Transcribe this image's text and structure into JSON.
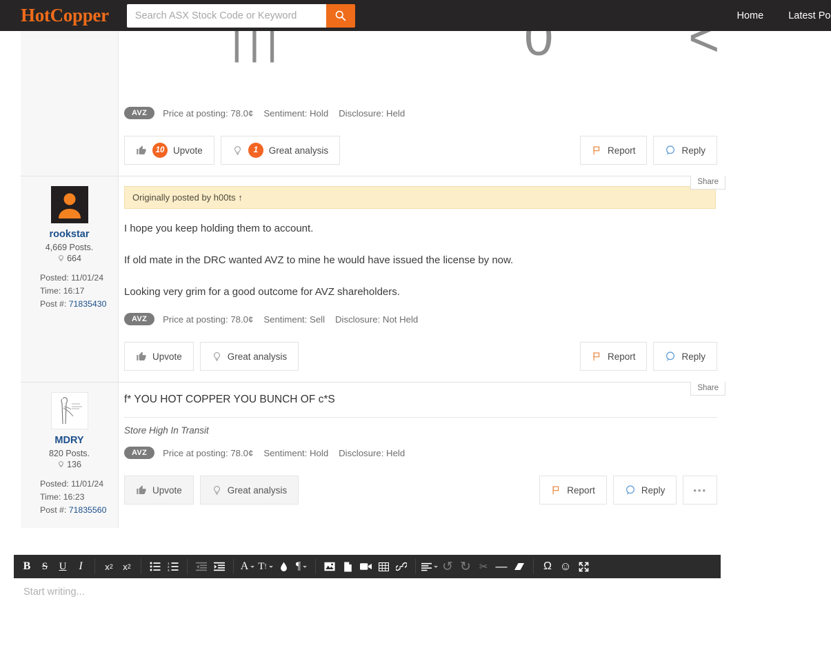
{
  "header": {
    "logo": "HotCopper",
    "search_placeholder": "Search ASX Stock Code or Keyword",
    "search_value": "",
    "search_icon": "search-icon",
    "nav": [
      {
        "label": "Home"
      },
      {
        "label": "Latest Posts"
      }
    ]
  },
  "truncated_post": {
    "glyphs": [
      "|||",
      "0",
      "<"
    ],
    "stock": {
      "ticker": "AVZ",
      "price": "Price at posting: 78.0¢",
      "sentiment": "Sentiment: Hold",
      "disclosure": "Disclosure: Held"
    },
    "actions": {
      "upvote": "Upvote",
      "upvote_count": "10",
      "great": "Great analysis",
      "great_count": "1",
      "report": "Report",
      "reply": "Reply"
    }
  },
  "posts": [
    {
      "share": "Share",
      "user": {
        "name": "rookstar",
        "posts": "4,669 Posts.",
        "bulb": "664",
        "posted": "Posted: 11/01/24",
        "time": "Time: 16:17",
        "postnum_label": "Post #:",
        "postnum": "71835430",
        "avatar_type": "orange-person"
      },
      "quote": "Originally posted by h00ts ↑",
      "paragraphs": [
        "I hope you keep holding them to account.",
        "If old mate in the DRC wanted AVZ to mine he would have issued the license by now.",
        "Looking very grim for a good outcome for AVZ shareholders."
      ],
      "stock": {
        "ticker": "AVZ",
        "price": "Price at posting: 78.0¢",
        "sentiment": "Sentiment: Sell",
        "disclosure": "Disclosure: Not Held"
      },
      "actions": {
        "upvote": "Upvote",
        "great": "Great analysis",
        "report": "Report",
        "reply": "Reply"
      }
    },
    {
      "share": "Share",
      "user": {
        "name": "MDRY",
        "posts": "820 Posts.",
        "bulb": "136",
        "posted": "Posted: 11/01/24",
        "time": "Time: 16:23",
        "postnum_label": "Post #:",
        "postnum": "71835560",
        "avatar_type": "sketch"
      },
      "title": "f* YOU HOT COPPER YOU BUNCH OF c*S",
      "signature": "Store High In Transit",
      "stock": {
        "ticker": "AVZ",
        "price": "Price at posting: 78.0¢",
        "sentiment": "Sentiment: Hold",
        "disclosure": "Disclosure: Held"
      },
      "actions": {
        "upvote": "Upvote",
        "great": "Great analysis",
        "report": "Report",
        "reply": "Reply",
        "more": "•••"
      }
    }
  ],
  "editor": {
    "placeholder": "Start writing...",
    "toolbar": [
      {
        "name": "bold-icon",
        "glyph": "B"
      },
      {
        "name": "strikethrough-icon",
        "glyph": "S"
      },
      {
        "name": "underline-icon",
        "glyph": "U"
      },
      {
        "name": "italic-icon",
        "glyph": "I"
      },
      {
        "name": "superscript-icon",
        "glyph": "x²"
      },
      {
        "name": "subscript-icon",
        "glyph": "x₂"
      },
      {
        "name": "bullet-list-icon",
        "glyph": "☰"
      },
      {
        "name": "numbered-list-icon",
        "glyph": "☰"
      },
      {
        "name": "outdent-icon",
        "glyph": "≡"
      },
      {
        "name": "indent-icon",
        "glyph": "≡"
      },
      {
        "name": "font-color-icon",
        "glyph": "A"
      },
      {
        "name": "font-size-icon",
        "glyph": "T!"
      },
      {
        "name": "highlight-color-icon",
        "glyph": "◆"
      },
      {
        "name": "paragraph-format-icon",
        "glyph": "¶"
      },
      {
        "name": "insert-image-icon",
        "glyph": "▣"
      },
      {
        "name": "insert-file-icon",
        "glyph": "□"
      },
      {
        "name": "insert-video-icon",
        "glyph": "▶"
      },
      {
        "name": "insert-table-icon",
        "glyph": "⊞"
      },
      {
        "name": "insert-link-icon",
        "glyph": "⚭"
      },
      {
        "name": "align-icon",
        "glyph": "≡"
      },
      {
        "name": "undo-icon",
        "glyph": "↺"
      },
      {
        "name": "redo-icon",
        "glyph": "↻"
      },
      {
        "name": "cut-icon",
        "glyph": "✂"
      },
      {
        "name": "horizontal-rule-icon",
        "glyph": "—"
      },
      {
        "name": "clear-formatting-icon",
        "glyph": "▱"
      },
      {
        "name": "special-character-icon",
        "glyph": "Ω"
      },
      {
        "name": "emoticon-icon",
        "glyph": "☺"
      },
      {
        "name": "fullscreen-icon",
        "glyph": "⤡"
      }
    ]
  },
  "colors": {
    "brand_orange": "#ef6c1a",
    "badge_orange": "#f26522",
    "header_dark": "#272525",
    "link_blue": "#1b4f8a",
    "reply_blue": "#5b9bd5",
    "quote_yellow": "#fbeec9",
    "ticker_grey": "#7b7b7b"
  }
}
